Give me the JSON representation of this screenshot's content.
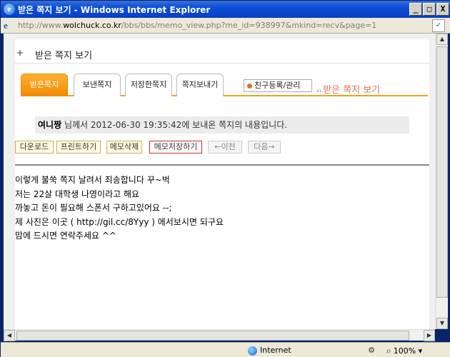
{
  "window": {
    "title": "받은 쪽지 보기 - Windows Internet Explorer",
    "min_label": "_",
    "max_label": "□",
    "close_label": "X"
  },
  "address": {
    "url_prefix": "http://www.",
    "url_domain": "wolchuck.co.kr",
    "url_rest": "/bbs/bbs/memo_view.php?me_id=938997&mkind=recv&page=1"
  },
  "page": {
    "header_bullet": "+",
    "header_title": "받은 쪽지 보기",
    "tabs": [
      {
        "label": "받은쪽지"
      },
      {
        "label": "보낸쪽지"
      },
      {
        "label": "저장한쪽지"
      },
      {
        "label": "쪽지보내기"
      }
    ],
    "friend_button": "친구등록/관리",
    "section_arrows": "››",
    "section_title": "받은 쪽지 보기",
    "info": {
      "sender": "여니짱",
      "suffix": " 님께서 2012-06-30 19:35:42에 보내온 쪽지의 내용입니다."
    },
    "actions": {
      "download": "다운로드",
      "print": "프린트하기",
      "delete": "메모삭제",
      "save": "메모저장하기",
      "prev": "←이전",
      "next": "다음→"
    },
    "message_lines": [
      "이렇게 불쑥 쪽지 날려서 죄송합니다 꾸~벅",
      "저는 22살 대학생 나영이라고 해요",
      "까놓고 돈이 필요해 스폰서 구하고있어요 --;",
      "제 사진은 이곳 ( http://gil.cc/8Yyy ) 에서보시면 되구요",
      "맘에 드시면 연락주세요 ^^"
    ]
  },
  "statusbar": {
    "zone": "Internet",
    "zoom": "100%"
  },
  "icons": {
    "app": "ie-icon",
    "page": "page-icon",
    "zone": "globe-icon",
    "zoom": "magnifier-icon"
  }
}
